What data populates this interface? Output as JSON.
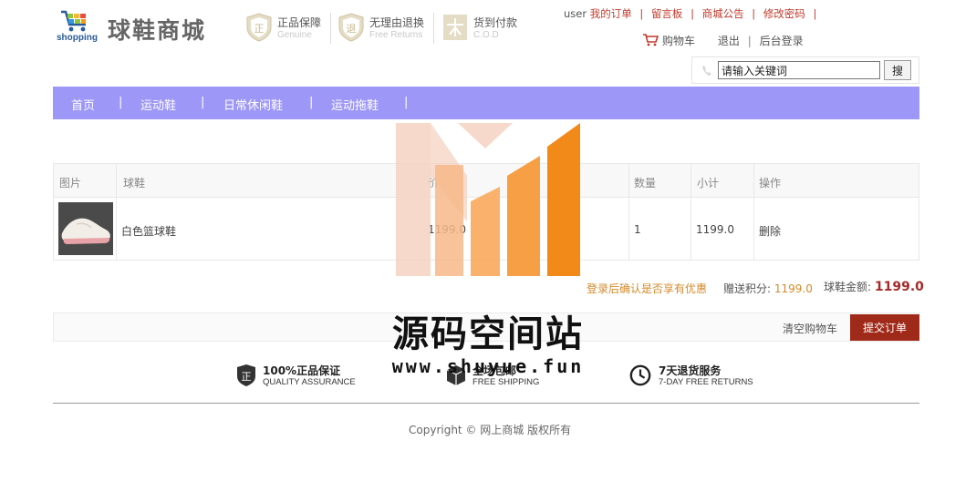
{
  "header": {
    "logo_text": "shopping",
    "shop_name": "球鞋商城",
    "promises": [
      {
        "title": "正品保障",
        "subtitle": "Genuine",
        "icon": "shield-zheng-icon"
      },
      {
        "title": "无理由退换",
        "subtitle": "Free Returns",
        "icon": "shield-tui-icon"
      },
      {
        "title": "货到付款",
        "subtitle": "C.O.D",
        "icon": "cod-icon"
      }
    ],
    "user": "user",
    "top_links": [
      "我的订单",
      "留言板",
      "商城公告",
      "修改密码"
    ],
    "cart_label": "购物车",
    "logout_label": "退出",
    "admin_login_label": "后台登录"
  },
  "search": {
    "value": "请输入关键词",
    "button_label": "搜"
  },
  "nav": {
    "items": [
      "首页",
      "运动鞋",
      "日常休闲鞋",
      "运动拖鞋"
    ]
  },
  "cart": {
    "columns": [
      "图片",
      "球鞋",
      "价",
      "数量",
      "小计",
      "操作"
    ],
    "rows": [
      {
        "name": "白色篮球鞋",
        "price": "1199.0",
        "quantity": "1",
        "subtotal": "1199.0",
        "action": "删除"
      }
    ],
    "promo_note": "登录后确认是否享有优惠",
    "points_label": "赠送积分:",
    "points_value": "1199.0",
    "total_label": "球鞋金额:",
    "total_value": "1199.0",
    "clear_label": "清空购物车",
    "submit_label": "提交订单"
  },
  "services": [
    {
      "title": "100%正品保证",
      "subtitle": "QUALITY ASSURANCE",
      "icon": "badge-zheng-icon"
    },
    {
      "title": "全场包邮",
      "subtitle": "FREE SHIPPING",
      "icon": "box-icon"
    },
    {
      "title": "7天退货服务",
      "subtitle": "7-DAY FREE RETURNS",
      "icon": "clock-icon"
    }
  ],
  "footer": {
    "copyright": "Copyright © 网上商城 版权所有"
  },
  "watermark": {
    "title": "源码空间站",
    "url": "www.shuyue.fun"
  },
  "colors": {
    "nav_bg": "#9d97f7",
    "link_red": "#c0392b",
    "submit_bg": "#a02a1a",
    "accent_orange": "#f28a1a"
  }
}
